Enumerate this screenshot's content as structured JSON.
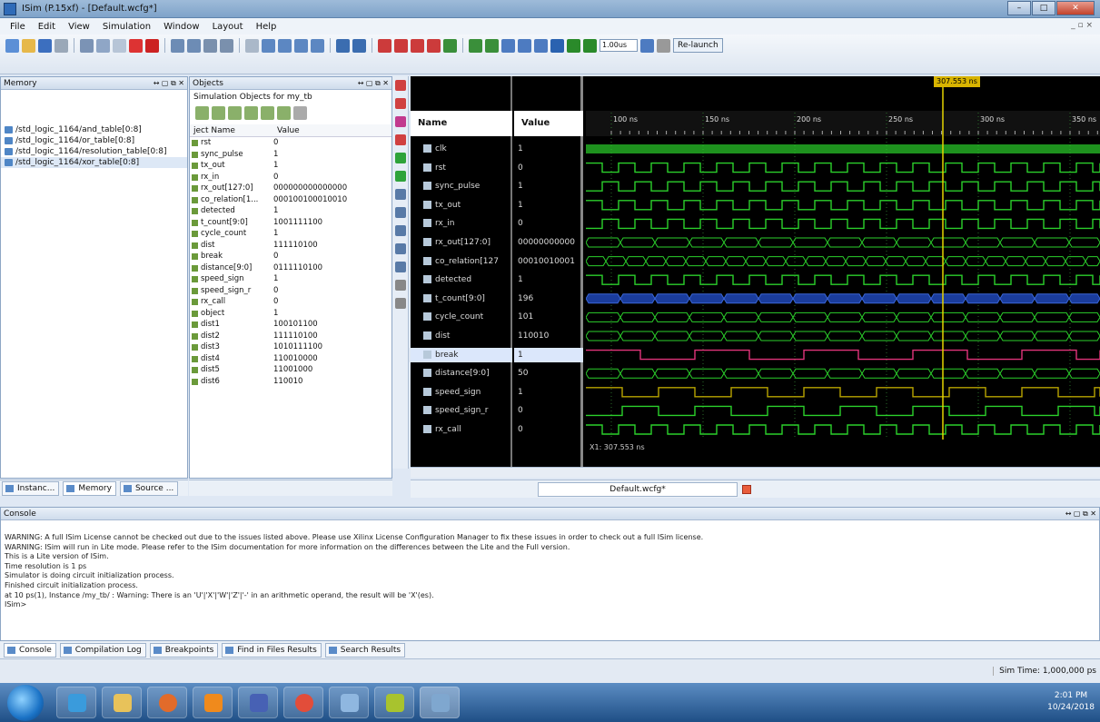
{
  "window": {
    "title": "ISim (P.15xf) - [Default.wcfg*]"
  },
  "menu": [
    "File",
    "Edit",
    "View",
    "Simulation",
    "Window",
    "Layout",
    "Help"
  ],
  "toolbar": {
    "time_value": "1.00us",
    "relaunch": "Re-launch"
  },
  "memory": {
    "title": "Memory",
    "items": [
      "/std_logic_1164/and_table[0:8]",
      "/std_logic_1164/or_table[0:8]",
      "/std_logic_1164/resolution_table[0:8]",
      "/std_logic_1164/xor_table[0:8]"
    ]
  },
  "objects": {
    "title": "Objects",
    "subtitle": "Simulation Objects for my_tb",
    "col_name": "ject Name",
    "col_value": "Value",
    "rows": [
      [
        "rst",
        "0"
      ],
      [
        "sync_pulse",
        "1"
      ],
      [
        "tx_out",
        "1"
      ],
      [
        "rx_in",
        "0"
      ],
      [
        "rx_out[127:0]",
        "000000000000000"
      ],
      [
        "co_relation[1...",
        "000100100010010"
      ],
      [
        "detected",
        "1"
      ],
      [
        "t_count[9:0]",
        "1001111100"
      ],
      [
        "cycle_count",
        "1"
      ],
      [
        "dist",
        "111110100"
      ],
      [
        "break",
        "0"
      ],
      [
        "distance[9:0]",
        "0111110100"
      ],
      [
        "speed_sign",
        "1"
      ],
      [
        "speed_sign_r",
        "0"
      ],
      [
        "rx_call",
        "0"
      ],
      [
        "object",
        "1"
      ],
      [
        "dist1",
        "100101100"
      ],
      [
        "dist2",
        "111110100"
      ],
      [
        "dist3",
        "1010111100"
      ],
      [
        "dist4",
        "110010000"
      ],
      [
        "dist5",
        "11001000"
      ],
      [
        "dist6",
        "110010"
      ]
    ]
  },
  "left_tabs": [
    "Instanc...",
    "Memory",
    "Source ..."
  ],
  "wave": {
    "name_header": "Name",
    "value_header": "Value",
    "cursor_label": "307.553 ns",
    "cursor_readout": "X1: 307.553 ns",
    "time_labels": [
      "100 ns",
      "150 ns",
      "200 ns",
      "250 ns",
      "300 ns",
      "350 ns"
    ],
    "signals": [
      [
        "clk",
        "1"
      ],
      [
        "rst",
        "0"
      ],
      [
        "sync_pulse",
        "1"
      ],
      [
        "tx_out",
        "1"
      ],
      [
        "rx_in",
        "0"
      ],
      [
        "rx_out[127:0]",
        "00000000000"
      ],
      [
        "co_relation[127",
        "00010010001"
      ],
      [
        "detected",
        "1"
      ],
      [
        "t_count[9:0]",
        "196"
      ],
      [
        "cycle_count",
        "101"
      ],
      [
        "dist",
        "110010"
      ],
      [
        "break",
        "1"
      ],
      [
        "distance[9:0]",
        "50"
      ],
      [
        "speed_sign",
        "1"
      ],
      [
        "speed_sign_r",
        "0"
      ],
      [
        "rx_call",
        "0"
      ]
    ],
    "tab": "Default.wcfg*"
  },
  "console": {
    "title": "Console",
    "lines": [
      "WARNING: A full ISim License cannot be checked out due to the issues listed above. Please use Xilinx License Configuration Manager to fix these issues in order to check out a full ISim license.",
      "WARNING: ISim will run in Lite mode. Please refer to the ISim documentation for more information on the differences between the Lite and the Full version.",
      "This is a Lite version of ISim.",
      "Time resolution is 1 ps",
      "Simulator is doing circuit initialization process.",
      "Finished circuit initialization process.",
      "at 10 ps(1), Instance /my_tb/ : Warning: There is an 'U'|'X'|'W'|'Z'|'-' in an arithmetic operand, the result will be 'X'(es).",
      "ISim>"
    ],
    "tabs": [
      "Console",
      "Compilation Log",
      "Breakpoints",
      "Find in Files Results",
      "Search Results"
    ]
  },
  "status": {
    "sim_time": "Sim Time: 1,000,000 ps"
  },
  "taskbar": {
    "time": "2:01 PM",
    "date": "10/24/2018"
  }
}
